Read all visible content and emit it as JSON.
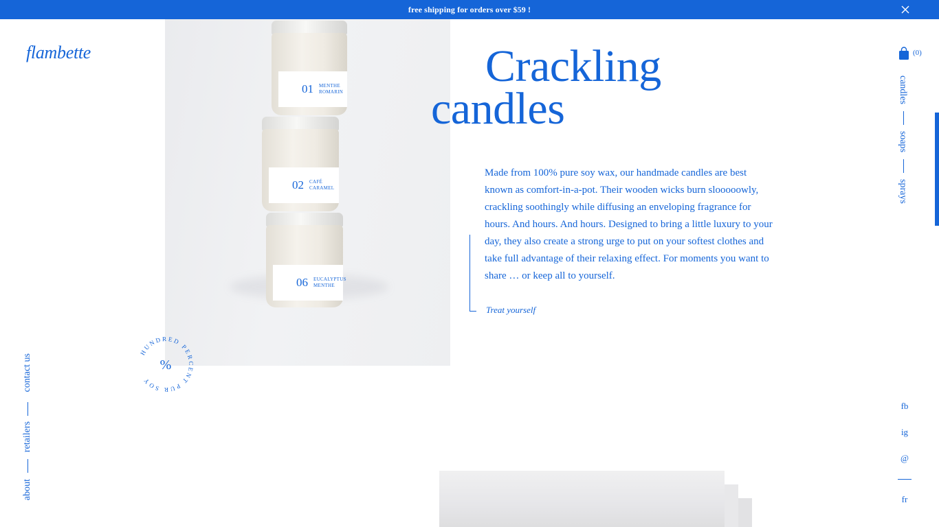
{
  "announcement": {
    "text": "free shipping for orders over $59 !"
  },
  "brand": {
    "logo": "flambette"
  },
  "hero": {
    "title_line1": "Crackling",
    "title_line2": "candles",
    "description": "Made from 100% pure soy wax, our handmade candles are best known as comfort-in-a-pot. Their wooden wicks burn slooooowly, crackling soothingly while diffusing an enveloping fragrance for hours. And hours. And hours. Designed to bring a little luxury to your day, they also create a strong urge to put on your softest clothes and take full advantage of their relaxing effect. For moments you want to share … or keep all to yourself.",
    "cta": "Treat yourself"
  },
  "jars": [
    {
      "num": "01",
      "name_line1": "MENTHE",
      "name_line2": "ROMARIN"
    },
    {
      "num": "02",
      "name_line1": "CAFÉ",
      "name_line2": "CARAMEL"
    },
    {
      "num": "06",
      "name_line1": "EUCALYPTUS",
      "name_line2": "MENTHE"
    }
  ],
  "badge": {
    "ring_text": "HUNDRED PERCENT PUR SOY",
    "symbol": "%"
  },
  "cart": {
    "icon": "shopping-bag-icon",
    "count": "(0)"
  },
  "right_nav": [
    "candles",
    "soaps",
    "sprays"
  ],
  "left_nav": [
    "contact us",
    "retailers",
    "about"
  ],
  "social": [
    "fb",
    "ig",
    "@"
  ],
  "language": "fr",
  "colors": {
    "accent": "#1565d8",
    "background": "#ffffff"
  }
}
